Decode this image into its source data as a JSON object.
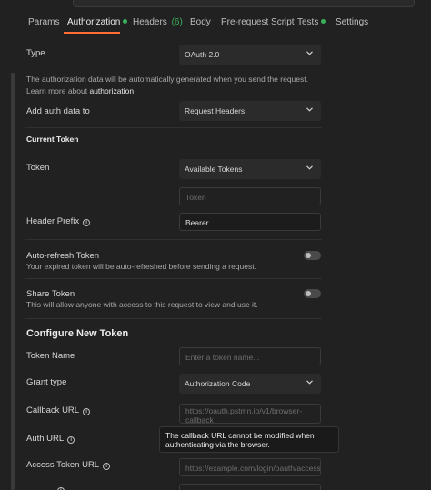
{
  "tabs": [
    {
      "label": "Params"
    },
    {
      "label": "Authorization",
      "has_dot": true,
      "active": true
    },
    {
      "label": "Headers",
      "count": "(6)"
    },
    {
      "label": "Body"
    },
    {
      "label": "Pre-request Script"
    },
    {
      "label": "Tests",
      "has_dot": true
    },
    {
      "label": "Settings"
    }
  ],
  "type": {
    "label": "Type",
    "value": "OAuth 2.0"
  },
  "auth_info": {
    "line1": "The authorization data will be automatically generated when you send the request.",
    "line2_prefix": "Learn more about ",
    "line2_link": "authorization"
  },
  "add_auth": {
    "label": "Add auth data to",
    "value": "Request Headers"
  },
  "current_token": {
    "heading": "Current Token",
    "token_label": "Token",
    "token_select": "Available Tokens",
    "token_placeholder": "Token",
    "header_prefix_label": "Header Prefix",
    "header_prefix_value": "Bearer"
  },
  "auto_refresh": {
    "label": "Auto-refresh Token",
    "desc": "Your expired token will be auto-refreshed before sending a request.",
    "enabled": false
  },
  "share_token": {
    "label": "Share Token",
    "desc": "This will allow anyone with access to this request to view and use it.",
    "enabled": false
  },
  "configure": {
    "heading": "Configure New Token",
    "token_name_label": "Token Name",
    "token_name_placeholder": "Enter a token name...",
    "grant_type_label": "Grant type",
    "grant_type_value": "Authorization Code",
    "callback_url_label": "Callback URL",
    "callback_url_value": "https://oauth.pstmn.io/v1/browser-callback",
    "auth_url_label": "Auth URL",
    "access_token_url_label": "Access Token URL",
    "access_token_url_placeholder": "https://example.com/login/oauth/access_token"
  },
  "tooltip": {
    "line1": "The callback URL cannot be modified when",
    "line2": "authenticating via the browser."
  },
  "colors": {
    "background": "#212121",
    "accent": "#ff6c37",
    "status_dot": "#3bb05a"
  }
}
